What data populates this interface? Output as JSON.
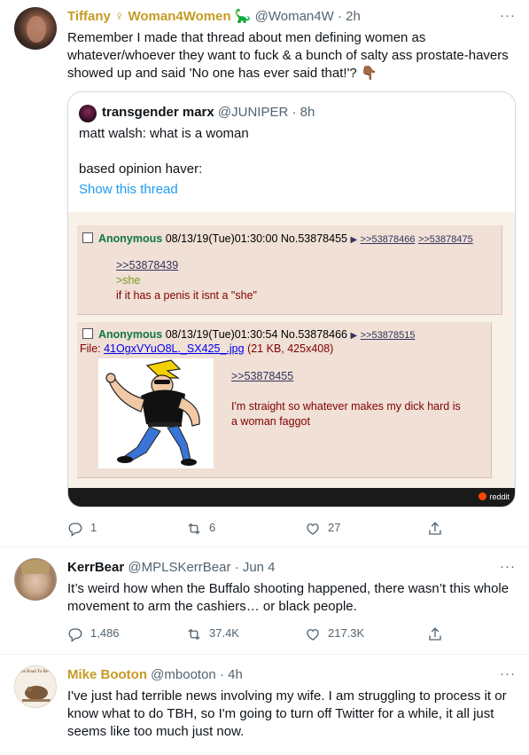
{
  "tweets": [
    {
      "name": "Tiffany ♀ Woman4Women 🦕",
      "handle": "@Woman4W",
      "time": "· 2h",
      "more": "···",
      "text": "Remember I made that thread about men defining women as whatever/whoever they want to fuck & a bunch of salty ass prostate-havers showed up and said 'No one has ever said that!'? 👇🏾",
      "quote": {
        "name": "transgender marx",
        "handle": "@JUNIPER",
        "time": "· 8h",
        "line1": "matt walsh: what is a woman",
        "line2": "based opinion haver:",
        "show_thread": "Show this thread",
        "post1": {
          "name": "Anonymous",
          "meta": "08/13/19(Tue)01:30:00 No.53878455",
          "backlinks": [
            ">>53878466",
            ">>53878475"
          ],
          "reply_link": ">>53878439",
          "greentext": ">she",
          "body": "if it has a penis it isnt a \"she\""
        },
        "post2": {
          "name": "Anonymous",
          "meta": "08/13/19(Tue)01:30:54 No.53878466",
          "backlinks": [
            ">>53878515"
          ],
          "file_prefix": "File:",
          "file_name": "41OgxVYuO8L._SX425_.jpg",
          "file_info": "(21 KB, 425x408)",
          "reply_link": ">>53878455",
          "body": "I'm straight so whatever makes my dick hard is a woman faggot"
        },
        "watermark": "reddit"
      },
      "replies": "1",
      "retweets": "6",
      "likes": "27"
    },
    {
      "name": "KerrBear",
      "handle": "@MPLSKerrBear",
      "time": "· Jun 4",
      "more": "···",
      "text": "It’s weird how when the Buffalo shooting happened, there wasn’t this whole movement to arm the cashiers… or black people.",
      "replies": "1,486",
      "retweets": "37.4K",
      "likes": "217.3K"
    },
    {
      "name": "Mike Booton",
      "handle": "@mbooton",
      "time": "· 4h",
      "more": "···",
      "text": "I've just had terrible news involving my wife. I am struggling to process it or know what to do TBH, so I'm going to turn off Twitter for a while, it all just seems like too much just now.",
      "avatar_text": "The Road To Be-Ye"
    }
  ],
  "colors": {
    "name_gold": "#c69b24",
    "secondary": "#536471",
    "link_blue": "#1d9bf0",
    "chan_green": "#117743",
    "chan_maroon": "#800000",
    "chan_bg": "#f0e0d6"
  },
  "icons": [
    "reply-icon",
    "retweet-icon",
    "like-icon",
    "share-icon",
    "more-icon"
  ]
}
